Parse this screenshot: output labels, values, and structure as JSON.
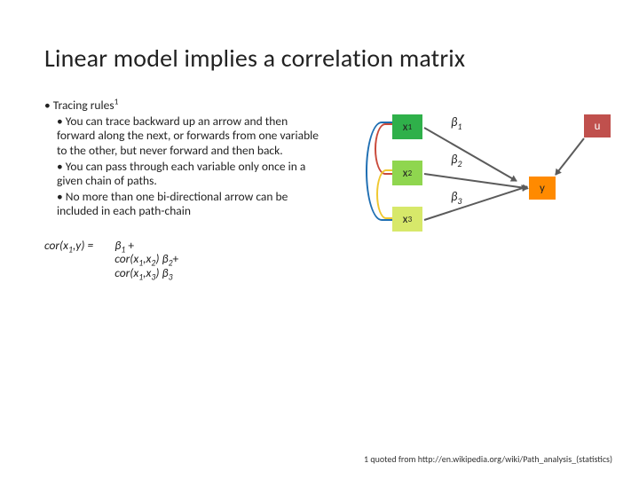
{
  "title": "Linear model implies a correlation matrix",
  "bullets": {
    "heading": "Tracing rules",
    "heading_sup": "1",
    "items": [
      "You can trace backward up an arrow and then forward along the next, or forwards from one variable to the other, but never forward and then back.",
      "You can pass through each variable only once in a given chain of paths.",
      "No more than one bi-directional arrow can be included in each path-chain"
    ]
  },
  "equation": {
    "lhs_pre": "cor(x",
    "lhs_sub1": "1",
    "lhs_mid": ",y) =",
    "line1_beta": "β",
    "line1_sub": "1",
    "line1_tail": " +",
    "line2_pre": "cor(x",
    "line2_s1": "1",
    "line2_mid": ",x",
    "line2_s2": "2",
    "line2_post": ") β",
    "line2_bsub": "2",
    "line2_tail": "+",
    "line3_pre": "cor(x",
    "line3_s1": "1",
    "line3_mid": ",x",
    "line3_s2": "3",
    "line3_post": ") β",
    "line3_bsub": "3"
  },
  "nodes": {
    "x1": "x",
    "x1_sub": "1",
    "x2": "x",
    "x2_sub": "2",
    "x3": "x",
    "x3_sub": "3",
    "y": "y",
    "u": "u"
  },
  "betas": {
    "b1": "β",
    "b1_sub": "1",
    "b2": "β",
    "b2_sub": "2",
    "b3": "β",
    "b3_sub": "3"
  },
  "footnote": "1 quoted from http://en.wikipedia.org/wiki/Path_analysis_(statistics)"
}
